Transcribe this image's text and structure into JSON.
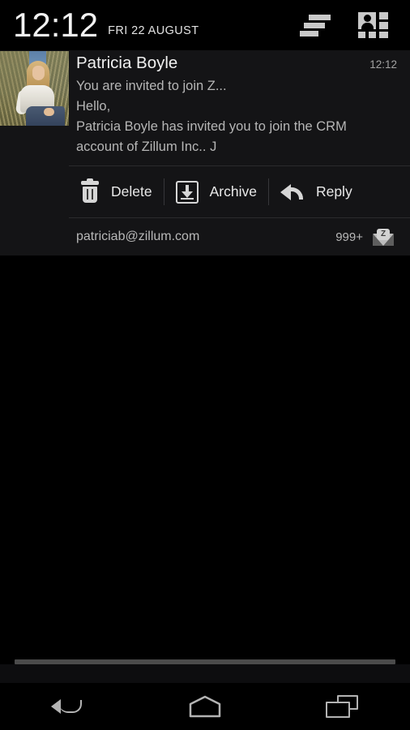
{
  "statusbar": {
    "time": "12:12",
    "date": "FRI 22 AUGUST",
    "icons": [
      {
        "name": "sort-list-icon"
      },
      {
        "name": "contacts-grid-icon"
      }
    ]
  },
  "notification": {
    "avatar_alt": "Patricia Boyle profile photo",
    "sender": "Patricia Boyle",
    "time": "12:12",
    "subject": "You are invited to join Z...",
    "body_line1": "Hello,",
    "body_line2": "Patricia Boyle has invited you to join the CRM",
    "body_line3": "account of Zillum Inc.. J",
    "actions": [
      {
        "id": "delete",
        "label": "Delete",
        "icon": "trash-icon"
      },
      {
        "id": "archive",
        "label": "Archive",
        "icon": "archive-down-arrow-icon"
      },
      {
        "id": "reply",
        "label": "Reply",
        "icon": "reply-arrow-icon"
      }
    ],
    "footer": {
      "email": "patriciab@zillum.com",
      "count": "999+",
      "mail_icon": "open-envelope-icon",
      "mail_badge_letter": "Z"
    }
  },
  "navbar": {
    "items": [
      {
        "id": "back",
        "icon": "back-arrow-icon"
      },
      {
        "id": "home",
        "icon": "home-pentagon-icon"
      },
      {
        "id": "recents",
        "icon": "recent-apps-icon"
      }
    ]
  },
  "colors": {
    "background": "#000000",
    "shade_bg": "#141416",
    "primary_text": "#f0f0f0",
    "secondary_text": "#b6b6b6",
    "muted_text": "#a2a2a2",
    "icon": "#d6d6d6",
    "nav_icon": "#b3b3b3",
    "divider": "#2b2b2d",
    "handle": "#4b4b4b"
  }
}
